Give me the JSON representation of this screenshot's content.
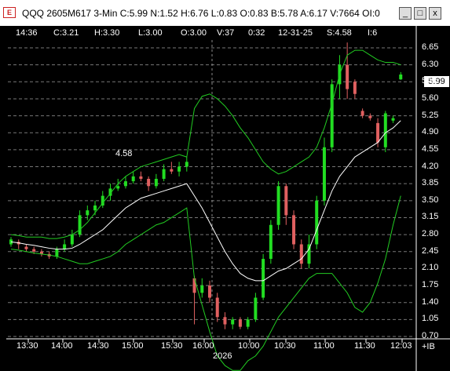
{
  "window": {
    "title": "QQQ 2605M617 3-Min C:5.99 N:1.52 H:6.76 L:0.83 O:0.83 B:5.78 A:6.17 V:7664 OI:0",
    "icon_label": "E",
    "buttons": {
      "minimize": "_",
      "maximize": "□",
      "close": "x"
    }
  },
  "header": {
    "time": "14:36",
    "close": "C:3.21",
    "high": "H:3.30",
    "low": "L:3.00",
    "open": "O:3.00",
    "volume": "V:37",
    "spread": "0:32",
    "date": "12-31-25",
    "strike": "S:4.58",
    "extra": "I:6"
  },
  "annotation": "4.58",
  "current_price": "5.99",
  "y_axis": [
    "6.65",
    "6.30",
    "5.95",
    "5.60",
    "5.25",
    "4.90",
    "4.55",
    "4.20",
    "3.85",
    "3.50",
    "3.15",
    "2.80",
    "2.45",
    "2.10",
    "1.75",
    "1.40",
    "1.05",
    "0.70"
  ],
  "y_corner": "+IB",
  "x_axis": [
    "13:30",
    "14:00",
    "14:30",
    "15:00",
    "15:30",
    "16:00",
    "10:00",
    "10:30",
    "11:00",
    "11:30",
    "12:03"
  ],
  "date_label": "2026",
  "colors": {
    "up": "#22dd22",
    "down": "#e06060",
    "band": "#22cc22",
    "ma": "#ffffff",
    "grid": "#777777",
    "background": "#000000"
  },
  "chart_data": {
    "type": "candlestick",
    "x": [
      "13:30",
      "14:00",
      "14:30",
      "15:00",
      "15:30",
      "16:00",
      "10:00",
      "10:30",
      "11:00",
      "11:30",
      "12:03"
    ],
    "ylim": [
      0.7,
      6.65
    ],
    "candles": [
      {
        "o": 2.6,
        "c": 2.7,
        "h": 2.75,
        "l": 2.55
      },
      {
        "o": 2.65,
        "c": 2.6,
        "h": 2.7,
        "l": 2.5
      },
      {
        "o": 2.55,
        "c": 2.5,
        "h": 2.6,
        "l": 2.45
      },
      {
        "o": 2.5,
        "c": 2.45,
        "h": 2.55,
        "l": 2.4
      },
      {
        "o": 2.45,
        "c": 2.4,
        "h": 2.5,
        "l": 2.35
      },
      {
        "o": 2.4,
        "c": 2.35,
        "h": 2.45,
        "l": 2.3
      },
      {
        "o": 2.35,
        "c": 2.5,
        "h": 2.55,
        "l": 2.3
      },
      {
        "o": 2.5,
        "c": 2.6,
        "h": 2.7,
        "l": 2.45
      },
      {
        "o": 2.6,
        "c": 2.8,
        "h": 2.9,
        "l": 2.55
      },
      {
        "o": 2.8,
        "c": 3.2,
        "h": 3.3,
        "l": 2.75
      },
      {
        "o": 3.2,
        "c": 3.3,
        "h": 3.4,
        "l": 3.1
      },
      {
        "o": 3.3,
        "c": 3.4,
        "h": 3.5,
        "l": 3.2
      },
      {
        "o": 3.4,
        "c": 3.6,
        "h": 3.7,
        "l": 3.35
      },
      {
        "o": 3.6,
        "c": 3.75,
        "h": 3.85,
        "l": 3.5
      },
      {
        "o": 3.75,
        "c": 3.8,
        "h": 3.95,
        "l": 3.7
      },
      {
        "o": 3.8,
        "c": 3.9,
        "h": 4.0,
        "l": 3.75
      },
      {
        "o": 3.9,
        "c": 4.0,
        "h": 4.1,
        "l": 3.85
      },
      {
        "o": 4.0,
        "c": 3.95,
        "h": 4.1,
        "l": 3.9
      },
      {
        "o": 3.95,
        "c": 3.8,
        "h": 4.0,
        "l": 3.7
      },
      {
        "o": 3.8,
        "c": 3.95,
        "h": 4.05,
        "l": 3.75
      },
      {
        "o": 3.95,
        "c": 4.15,
        "h": 4.25,
        "l": 3.9
      },
      {
        "o": 4.15,
        "c": 4.1,
        "h": 4.3,
        "l": 4.05
      },
      {
        "o": 4.1,
        "c": 4.2,
        "h": 4.3,
        "l": 4.0
      },
      {
        "o": 4.2,
        "c": 4.3,
        "h": 4.4,
        "l": 4.1
      },
      {
        "o": 1.9,
        "c": 1.6,
        "h": 1.95,
        "l": 0.95
      },
      {
        "o": 1.6,
        "c": 1.75,
        "h": 1.9,
        "l": 1.5
      },
      {
        "o": 1.75,
        "c": 1.5,
        "h": 1.85,
        "l": 1.4
      },
      {
        "o": 1.5,
        "c": 1.1,
        "h": 1.6,
        "l": 1.0
      },
      {
        "o": 1.1,
        "c": 0.95,
        "h": 1.2,
        "l": 0.85
      },
      {
        "o": 0.95,
        "c": 1.05,
        "h": 1.1,
        "l": 0.85
      },
      {
        "o": 1.05,
        "c": 0.9,
        "h": 1.1,
        "l": 0.85
      },
      {
        "o": 0.9,
        "c": 1.05,
        "h": 1.1,
        "l": 0.85
      },
      {
        "o": 1.05,
        "c": 1.5,
        "h": 1.6,
        "l": 1.0
      },
      {
        "o": 1.5,
        "c": 2.3,
        "h": 2.4,
        "l": 1.45
      },
      {
        "o": 2.3,
        "c": 3.0,
        "h": 3.1,
        "l": 2.2
      },
      {
        "o": 3.0,
        "c": 3.8,
        "h": 3.9,
        "l": 2.9
      },
      {
        "o": 3.8,
        "c": 3.2,
        "h": 3.85,
        "l": 3.0
      },
      {
        "o": 3.2,
        "c": 2.6,
        "h": 3.3,
        "l": 2.5
      },
      {
        "o": 2.6,
        "c": 2.2,
        "h": 2.7,
        "l": 2.1
      },
      {
        "o": 2.2,
        "c": 2.6,
        "h": 2.8,
        "l": 2.1
      },
      {
        "o": 2.6,
        "c": 3.5,
        "h": 3.6,
        "l": 2.5
      },
      {
        "o": 3.5,
        "c": 4.6,
        "h": 4.8,
        "l": 3.4
      },
      {
        "o": 4.6,
        "c": 5.9,
        "h": 6.0,
        "l": 4.5
      },
      {
        "o": 5.9,
        "c": 6.3,
        "h": 6.5,
        "l": 5.6
      },
      {
        "o": 6.3,
        "c": 5.8,
        "h": 6.76,
        "l": 5.6
      },
      {
        "o": 5.95,
        "c": 5.7,
        "h": 6.0,
        "l": 5.6
      },
      {
        "o": 5.35,
        "c": 5.25,
        "h": 5.4,
        "l": 5.2
      },
      {
        "o": 5.25,
        "c": 5.2,
        "h": 5.3,
        "l": 5.15
      },
      {
        "o": 5.1,
        "c": 4.7,
        "h": 5.2,
        "l": 4.6
      },
      {
        "o": 4.6,
        "c": 5.3,
        "h": 5.35,
        "l": 4.5
      },
      {
        "o": 5.15,
        "c": 5.2,
        "h": 5.25,
        "l": 5.1
      },
      {
        "o": 6.0,
        "c": 6.1,
        "h": 6.15,
        "l": 5.99
      }
    ],
    "series": [
      {
        "name": "upper",
        "values": [
          2.8,
          2.78,
          2.75,
          2.75,
          2.75,
          2.72,
          2.72,
          2.75,
          2.8,
          2.9,
          3.05,
          3.25,
          3.45,
          3.65,
          3.85,
          4.0,
          4.1,
          4.2,
          4.25,
          4.3,
          4.35,
          4.4,
          4.45,
          4.4,
          5.4,
          5.65,
          5.7,
          5.6,
          5.45,
          5.25,
          5.0,
          4.8,
          4.55,
          4.3,
          4.15,
          4.05,
          4.1,
          4.2,
          4.3,
          4.4,
          4.6,
          5.0,
          5.5,
          6.1,
          6.5,
          6.6,
          6.6,
          6.5,
          6.4,
          6.35,
          6.35,
          6.3
        ]
      },
      {
        "name": "ma",
        "values": [
          2.65,
          2.63,
          2.6,
          2.58,
          2.55,
          2.52,
          2.5,
          2.5,
          2.52,
          2.6,
          2.7,
          2.8,
          2.9,
          3.05,
          3.2,
          3.35,
          3.45,
          3.55,
          3.6,
          3.65,
          3.7,
          3.75,
          3.8,
          3.85,
          3.6,
          3.35,
          3.05,
          2.75,
          2.45,
          2.2,
          2.0,
          1.9,
          1.85,
          1.85,
          1.95,
          2.05,
          2.1,
          2.2,
          2.3,
          2.5,
          2.9,
          3.3,
          3.7,
          4.0,
          4.2,
          4.4,
          4.5,
          4.6,
          4.7,
          4.9,
          5.0,
          5.15
        ]
      },
      {
        "name": "lower",
        "values": [
          2.5,
          2.48,
          2.45,
          2.42,
          2.4,
          2.38,
          2.35,
          2.3,
          2.25,
          2.2,
          2.2,
          2.25,
          2.3,
          2.35,
          2.45,
          2.6,
          2.7,
          2.8,
          2.9,
          3.0,
          3.05,
          3.15,
          3.25,
          3.35,
          1.9,
          1.35,
          0.8,
          0.3,
          0.1,
          0.0,
          0.0,
          0.2,
          0.3,
          0.5,
          0.8,
          1.1,
          1.3,
          1.5,
          1.7,
          1.9,
          2.0,
          2.0,
          2.0,
          1.8,
          1.6,
          1.3,
          1.2,
          1.4,
          1.8,
          2.3,
          3.0,
          3.6
        ]
      }
    ]
  }
}
